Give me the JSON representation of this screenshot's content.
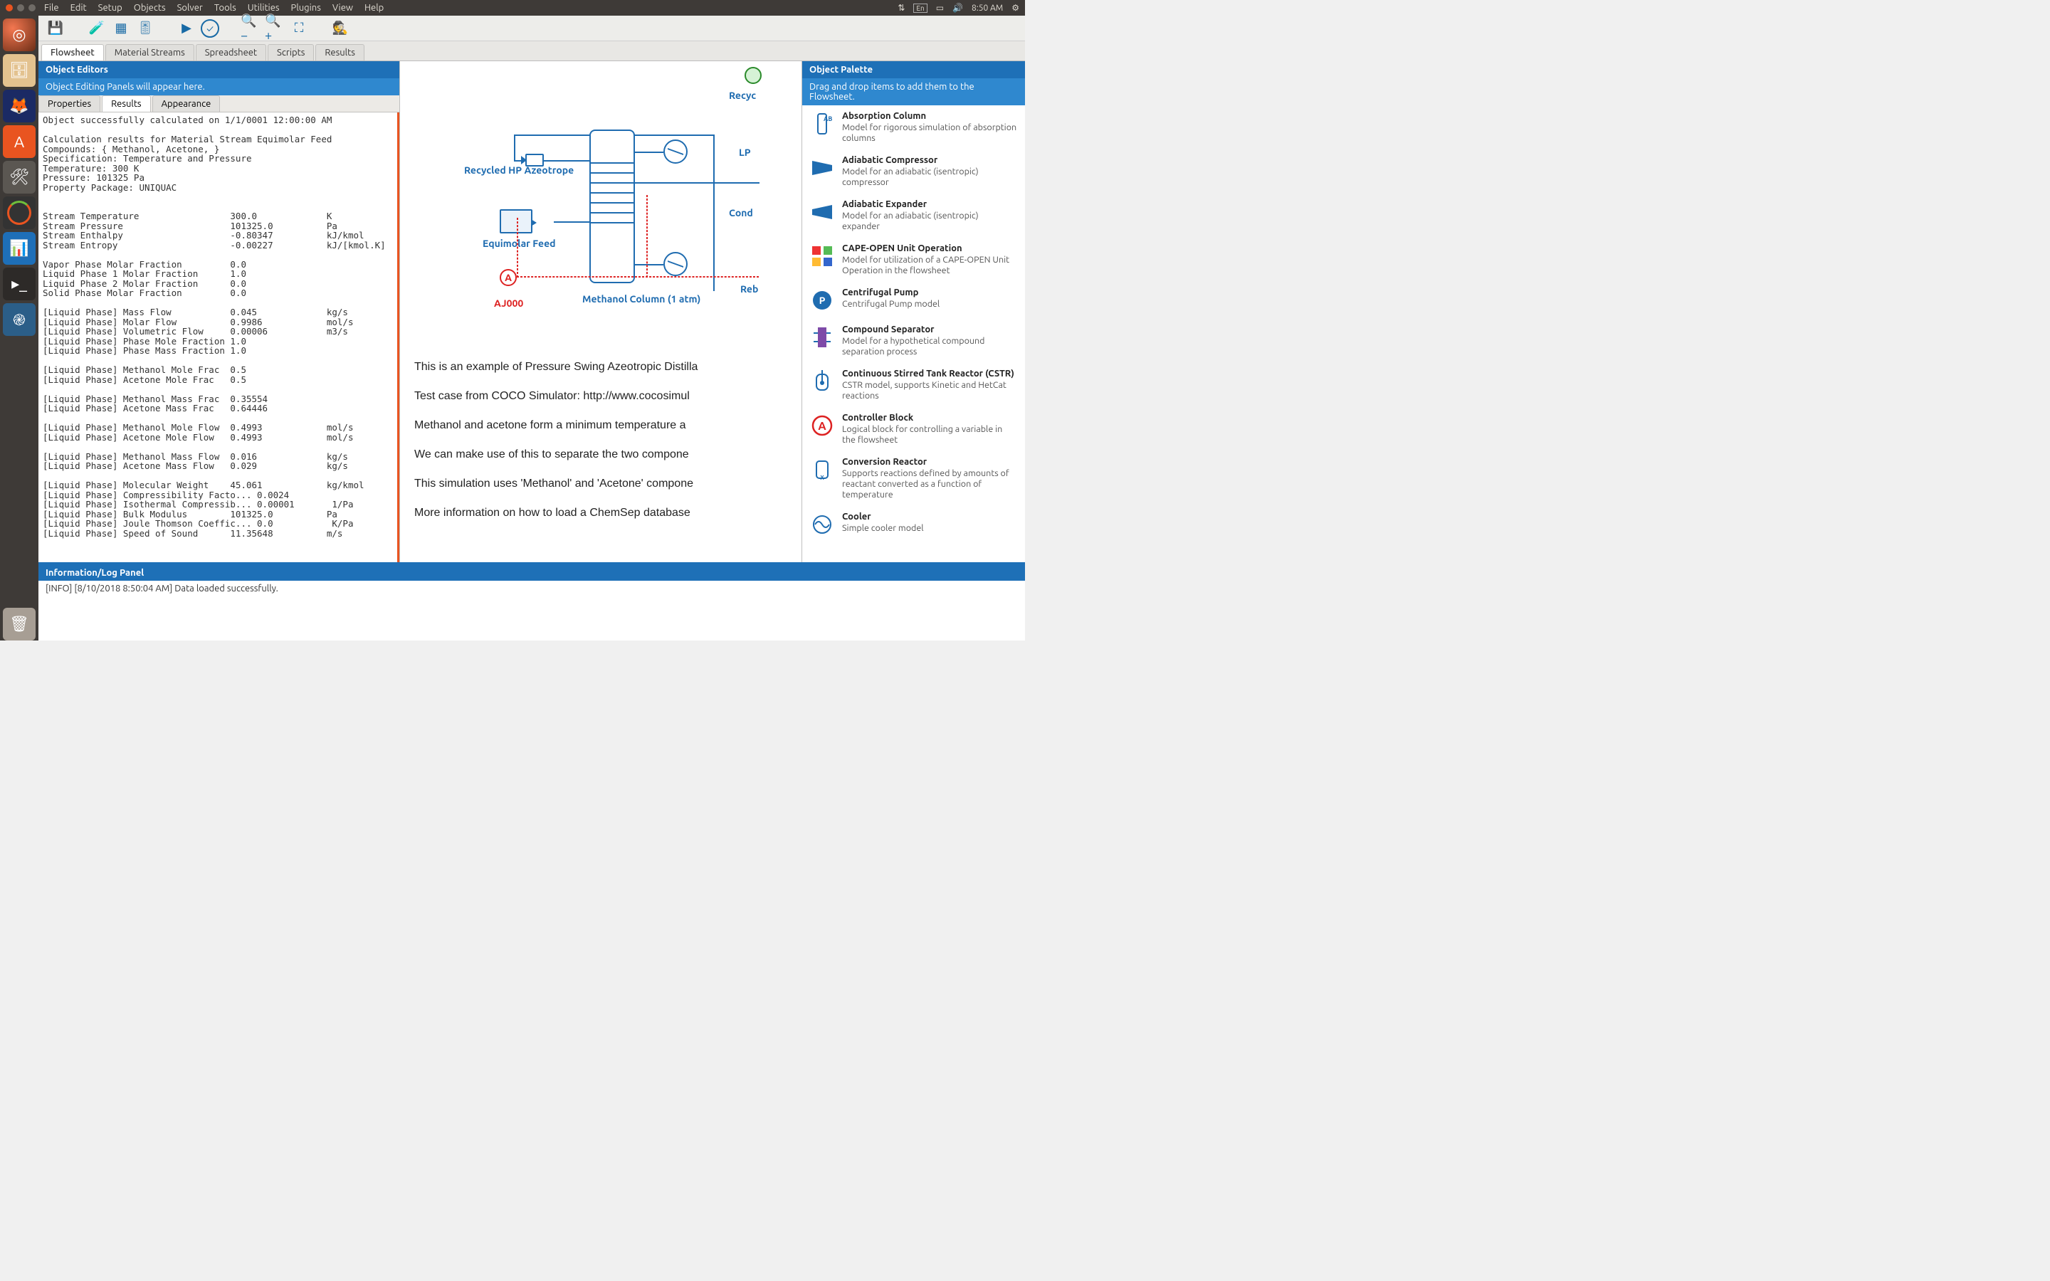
{
  "system": {
    "menu": [
      "File",
      "Edit",
      "Setup",
      "Objects",
      "Solver",
      "Tools",
      "Utilities",
      "Plugins",
      "View",
      "Help"
    ],
    "lang_ind": "En",
    "clock": "8:50 AM"
  },
  "tabs": [
    "Flowsheet",
    "Material Streams",
    "Spreadsheet",
    "Scripts",
    "Results"
  ],
  "active_tab": "Flowsheet",
  "left_panel": {
    "header": "Object Editors",
    "subheader": "Object Editing Panels will appear here.",
    "sub_tabs": [
      "Properties",
      "Results",
      "Appearance"
    ],
    "active_sub_tab": "Results",
    "results_text": "Object successfully calculated on 1/1/0001 12:00:00 AM\n\nCalculation results for Material Stream Equimolar Feed\nCompounds: { Methanol, Acetone, }\nSpecification: Temperature and Pressure\nTemperature: 300 K\nPressure: 101325 Pa\nProperty Package: UNIQUAC\n\n\nStream Temperature                 300.0             K\nStream Pressure                    101325.0          Pa\nStream Enthalpy                    -0.80347          kJ/kmol\nStream Entropy                     -0.00227          kJ/[kmol.K]\n\nVapor Phase Molar Fraction         0.0\nLiquid Phase 1 Molar Fraction      1.0\nLiquid Phase 2 Molar Fraction      0.0\nSolid Phase Molar Fraction         0.0\n\n[Liquid Phase] Mass Flow           0.045             kg/s\n[Liquid Phase] Molar Flow          0.9986            mol/s\n[Liquid Phase] Volumetric Flow     0.00006           m3/s\n[Liquid Phase] Phase Mole Fraction 1.0\n[Liquid Phase] Phase Mass Fraction 1.0\n\n[Liquid Phase] Methanol Mole Frac  0.5\n[Liquid Phase] Acetone Mole Frac   0.5\n\n[Liquid Phase] Methanol Mass Frac  0.35554\n[Liquid Phase] Acetone Mass Frac   0.64446\n\n[Liquid Phase] Methanol Mole Flow  0.4993            mol/s\n[Liquid Phase] Acetone Mole Flow   0.4993            mol/s\n\n[Liquid Phase] Methanol Mass Flow  0.016             kg/s\n[Liquid Phase] Acetone Mass Flow   0.029             kg/s\n\n[Liquid Phase] Molecular Weight    45.061            kg/kmol\n[Liquid Phase] Compressibility Facto... 0.0024\n[Liquid Phase] Isothermal Compressib... 0.00001       1/Pa\n[Liquid Phase] Bulk Modulus        101325.0          Pa\n[Liquid Phase] Joule Thomson Coeffic... 0.0           K/Pa\n[Liquid Phase] Speed of Sound      11.35648          m/s"
  },
  "flowsheet": {
    "label_recycled": "Recycled HP Azeotrope",
    "label_feed": "Equimolar Feed",
    "label_col": "Methanol Column (1 atm)",
    "label_aj": "AJ000",
    "label_recyc_top": "Recyc",
    "label_lp": "LP",
    "label_cond": "Cond",
    "label_reb": "Reb",
    "desc_lines": [
      "This is an example of Pressure Swing Azeotropic Distilla",
      "Test case from COCO Simulator: http://www.cocosimul",
      "Methanol and acetone form a minimum temperature a",
      "We can make use of this to separate the two compone",
      "This simulation uses 'Methanol' and 'Acetone' compone",
      "More information on how to load a ChemSep database"
    ]
  },
  "palette": {
    "header": "Object Palette",
    "subheader": "Drag and drop items to add them to the Flowsheet.",
    "items": [
      {
        "title": "Absorption Column",
        "desc": "Model for rigorous simulation of absorption columns",
        "icon": "abs"
      },
      {
        "title": "Adiabatic Compressor",
        "desc": "Model for an adiabatic (isentropic) compressor",
        "icon": "comp"
      },
      {
        "title": "Adiabatic Expander",
        "desc": "Model for an adiabatic (isentropic) expander",
        "icon": "exp"
      },
      {
        "title": "CAPE-OPEN Unit Operation",
        "desc": "Model for utilization of a CAPE-OPEN Unit Operation in the flowsheet",
        "icon": "cape"
      },
      {
        "title": "Centrifugal Pump",
        "desc": "Centrifugal Pump model",
        "icon": "pump"
      },
      {
        "title": "Compound Separator",
        "desc": "Model for a hypothetical compound separation process",
        "icon": "csep"
      },
      {
        "title": "Continuous Stirred Tank Reactor (CSTR)",
        "desc": "CSTR model, supports Kinetic and HetCat reactions",
        "icon": "cstr"
      },
      {
        "title": "Controller Block",
        "desc": "Logical block for controlling a variable in the flowsheet",
        "icon": "ctrl"
      },
      {
        "title": "Conversion Reactor",
        "desc": "Supports reactions defined by amounts of reactant converted as a function of temperature",
        "icon": "conv"
      },
      {
        "title": "Cooler",
        "desc": "Simple cooler model",
        "icon": "cool"
      }
    ]
  },
  "log": {
    "header": "Information/Log Panel",
    "line": "[INFO] [8/10/2018 8:50:04 AM] Data loaded successfully."
  }
}
